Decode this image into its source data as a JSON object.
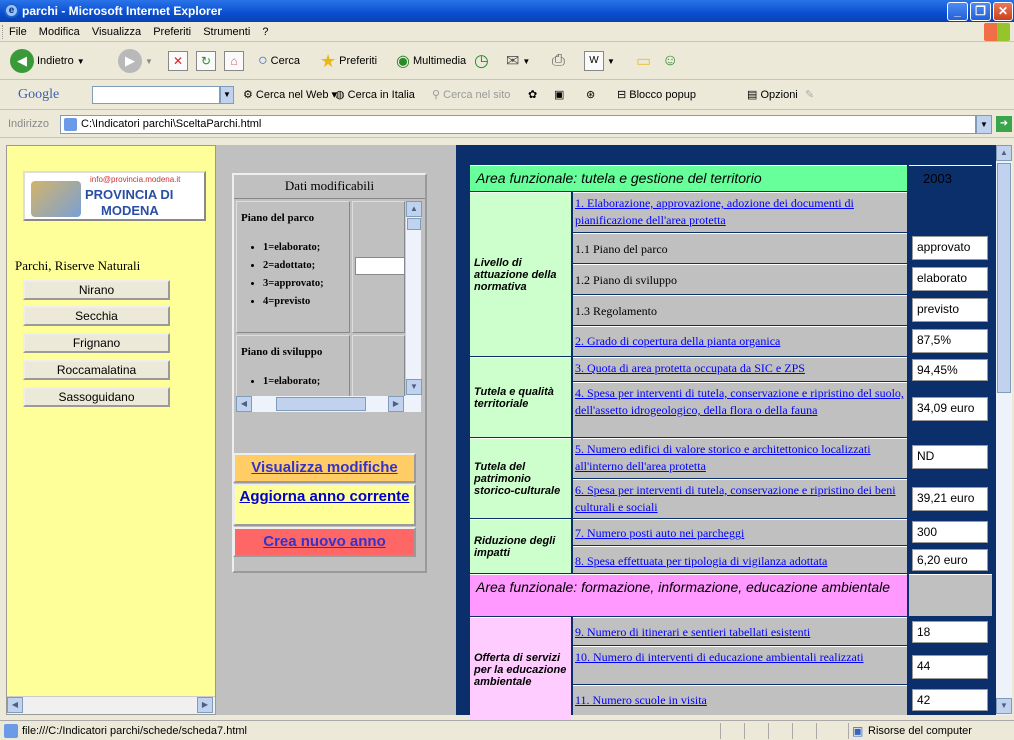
{
  "window": {
    "title": "parchi - Microsoft Internet Explorer"
  },
  "menu": [
    "File",
    "Modifica",
    "Visualizza",
    "Preferiti",
    "Strumenti",
    "?"
  ],
  "toolbar": {
    "back": "Indietro",
    "search": "Cerca",
    "favorites": "Preferiti",
    "media": "Multimedia"
  },
  "google": {
    "logo": "Google",
    "search_web": "Cerca nel Web",
    "search_italy": "Cerca in Italia",
    "search_site": "Cerca nel sito",
    "popup": "Blocco popup",
    "options": "Opzioni"
  },
  "address": {
    "label": "Indirizzo",
    "url": "C:\\Indicatori parchi\\SceltaParchi.html",
    "go": "Vai"
  },
  "left": {
    "logo_email": "info@provincia.modena.it",
    "logo_line1": "PROVINCIA DI",
    "logo_line2": "MODENA",
    "heading": "Parchi, Riserve Naturali",
    "parks": [
      "Nirano",
      "Secchia",
      "Frignano",
      "Roccamalatina",
      "Sassoguidano"
    ]
  },
  "mid": {
    "title": "Dati modificabili",
    "piano_parco": "Piano del parco",
    "options": [
      "1=elaborato;",
      "2=adottato;",
      "3=approvato;",
      "4=previsto"
    ],
    "piano_sviluppo": "Piano di sviluppo",
    "options2": [
      "1=elaborato;"
    ],
    "btn_visualizza": "Visualizza modifiche",
    "btn_aggiorna": "Aggiorna anno corrente",
    "btn_crea": "Crea nuovo anno"
  },
  "table": {
    "area1": "Area funzionale: tutela e gestione del territorio",
    "year": "2003",
    "group1": "Livello di attuazione della normativa",
    "r1": "1. Elaborazione, approvazione, adozione dei documenti di pianificazione dell'area protetta",
    "r11": "1.1 Piano del parco",
    "v11": "approvato",
    "r12": "1.2 Piano di sviluppo",
    "v12": "elaborato",
    "r13": "1.3 Regolamento",
    "v13": "previsto",
    "r2": "2. Grado di copertura della pianta organica",
    "v2": "87,5%",
    "group2": "Tutela e qualità territoriale",
    "r3": "3. Quota di area protetta occupata da SIC e ZPS",
    "v3": "94,45%",
    "r4": "4. Spesa per interventi di tutela, conservazione e ripristino del suolo, dell'assetto idrogeologico, della flora o della fauna",
    "v4": "34,09 euro",
    "group3": "Tutela del patrimonio storico-culturale",
    "r5": "5. Numero edifici di valore storico e architettonico localizzati all'interno dell'area protetta",
    "v5": "ND",
    "r6": "6. Spesa per interventi di tutela, conservazione e ripristino dei beni culturali e sociali",
    "v6": "39,21 euro",
    "group4": "Riduzione degli impatti",
    "r7": "7. Numero posti auto nei parcheggi",
    "v7": "300",
    "r8": "8. Spesa effettuata per tipologia di vigilanza adottata",
    "v8": "6,20 euro",
    "area2": "Area funzionale: formazione, informazione, educazione ambientale",
    "group5": "Offerta di servizi per la educazione ambientale",
    "r9": "9. Numero di itinerari e sentieri tabellati esistenti",
    "v9": "18",
    "r10": "10. Numero di interventi di educazione ambientali realizzati",
    "v10": "44",
    "r11b": "11. Numero scuole in visita",
    "v11b": "42"
  },
  "status": {
    "text": "file:///C:/Indicatori parchi/schede/scheda7.html",
    "zone": "Risorse del computer"
  }
}
